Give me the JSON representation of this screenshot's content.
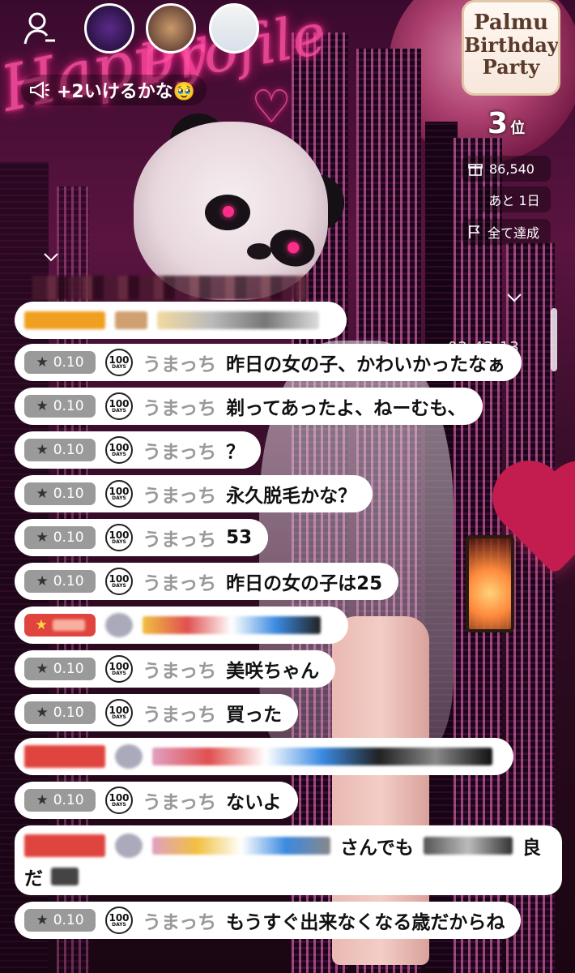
{
  "announcement": {
    "text": "+2いけるかな🥹"
  },
  "event_badge": {
    "line1": "Palmu",
    "line2": "Birthday",
    "line3": "Party"
  },
  "rank": {
    "value": "3",
    "unit": "位"
  },
  "stats": {
    "points": "86,540",
    "remaining": "あと 1日",
    "goal": "全て達成"
  },
  "timestamp": "02:43:13",
  "icons": [
    "profile-icon",
    "megaphone-icon",
    "gift-icon",
    "flag-icon",
    "chevron-down-icon",
    "star-icon",
    "100-days-badge-icon"
  ],
  "colors": {
    "accent_neon": "#ff4fa3",
    "comment_bg": "#ffffff",
    "pill_gray": "#9a9a9a",
    "pill_red": "#e0443f",
    "pill_orange": "#f0a020"
  },
  "comments": [
    {
      "level": "0.10",
      "badge": "100",
      "badge_sub": "DAYS",
      "user": "うまっち",
      "text": "昨日の女の子、かわいかったなぁ"
    },
    {
      "level": "0.10",
      "badge": "100",
      "badge_sub": "DAYS",
      "user": "うまっち",
      "text": "剃ってあったよ、ねーむも、"
    },
    {
      "level": "0.10",
      "badge": "100",
      "badge_sub": "DAYS",
      "user": "うまっち",
      "text": "？"
    },
    {
      "level": "0.10",
      "badge": "100",
      "badge_sub": "DAYS",
      "user": "うまっち",
      "text": "永久脱毛かな？"
    },
    {
      "level": "0.10",
      "badge": "100",
      "badge_sub": "DAYS",
      "user": "うまっち",
      "text": "53"
    },
    {
      "level": "0.10",
      "badge": "100",
      "badge_sub": "DAYS",
      "user": "うまっち",
      "text": "昨日の女の子は25"
    },
    {
      "level": "0.10",
      "badge": "100",
      "badge_sub": "DAYS",
      "user": "うまっち",
      "text": "美咲ちゃん"
    },
    {
      "level": "0.10",
      "badge": "100",
      "badge_sub": "DAYS",
      "user": "うまっち",
      "text": "買った"
    },
    {
      "level": "0.10",
      "badge": "100",
      "badge_sub": "DAYS",
      "user": "うまっち",
      "text": "ないよ"
    },
    {
      "level": "0.10",
      "badge": "100",
      "badge_sub": "DAYS",
      "user": "うまっち",
      "text": "もうすぐ出来なくなる歳だからね"
    }
  ],
  "partial_comments": [
    {
      "text": "さんでも",
      "text2": "良",
      "line2": "だ"
    }
  ]
}
